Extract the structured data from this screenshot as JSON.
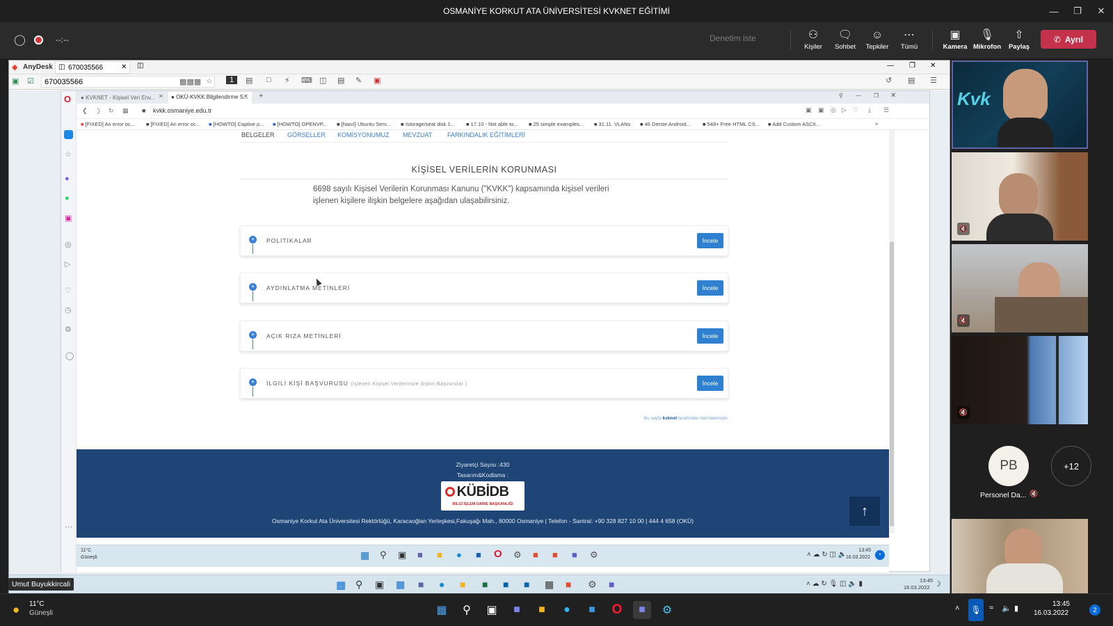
{
  "teams": {
    "title": "OSMANİYE KORKUT ATA ÜNİVERSİTESİ KVKNET EĞİTİMİ",
    "timer": "--:--",
    "ask_control": "Denetim iste",
    "buttons": {
      "people": "Kişiler",
      "chat": "Sohbet",
      "reactions": "Tepkiler",
      "more": "Tümü",
      "camera": "Kamera",
      "mic": "Mikrofon",
      "share": "Paylaş",
      "leave": "Ayrıl"
    },
    "presenter_name": "Umut Buyukkircali",
    "participant_initials": "PB",
    "participant_name": "Personel Da...",
    "more_count": "+12",
    "colors": {
      "leave": "#c4314b",
      "background": "#1f1f1f",
      "pb_circle": "#f4f1ea"
    }
  },
  "anydesk": {
    "brand": "AnyDesk",
    "tab_id": "670035566",
    "address": "670035566"
  },
  "browser": {
    "tabs": [
      "KVKNET - Kişisel Veri Env...",
      "OKÜ-KVKK Bilgilendirme S..."
    ],
    "url": "kvkk.osmaniye.edu.tr",
    "bookmarks": [
      "[FIXED] An error oc...",
      "[FIXED] An error oc...",
      "[HOWTO] Captive p...",
      "[HOWTO] OPENVP...",
      "[Nasıl] Ubuntu Serv...",
      "/storage/seat disk 1...",
      "17.10 - Not able to...",
      "25 simple examples...",
      "31.11. VLANs",
      "46 Derste Android...",
      "548+ Free HTML CS...",
      "Add Custom ASCII..."
    ]
  },
  "page": {
    "nav": [
      "BELGELER",
      "GÖRSELLER",
      "KOMİSYONUMUZ",
      "MEVZUAT",
      "FARKINDALIK EĞİTİMLERİ"
    ],
    "heading": "KİŞİSEL VERİLERİN KORUNMASI",
    "intro_line1": "6698 sayılı Kişisel Verilerin Korunması Kanunu (\"KVKK\") kapsamında kişisel verileri",
    "intro_line2": "işlenen kişilere ilişkin belgelere aşağıdan ulaşabilirsiniz.",
    "sections": [
      {
        "label": "POLİTİKALAR",
        "sub": "",
        "button": "İncele"
      },
      {
        "label": "AYDINLATMA METİNLERİ",
        "sub": "",
        "button": "İncele"
      },
      {
        "label": "AÇIK RIZA METİNLERİ",
        "sub": "",
        "button": "İncele"
      },
      {
        "label": "İLGİLİ KİŞİ BAŞVURUSU",
        "sub": "(İşlenen Kişisel Verilerinize İlişkin Başvurular )",
        "button": "İncele"
      }
    ],
    "credit_prefix": "Bu sayfa",
    "credit_brand": "kvknet",
    "credit_suffix": "tarafından hazırlanmıştır.",
    "footer": {
      "visitors": "Ziyaretçi Sayısı :430",
      "design": "Tasarım&Kodlama :",
      "logo_text": "KÜBİDB",
      "logo_sub": "BİLGİ İŞLEM DAİRE BAŞKANLIĞI",
      "address": "Osmaniye Korkut Ata Üniversitesi Rektörlüğü, Karacaoğlan Yerleşkesi,Fakuşağı Mah., 80000 Osmaniye | Telefon - Santral: +90 328 827 10 00 | 444 4 658 (OKÜ)"
    }
  },
  "remote_taskbar": {
    "weather_temp": "11°C",
    "weather_desc": "Güneşli",
    "time": "13:45",
    "date": "16.03.2022"
  },
  "taskbar": {
    "weather_temp": "11°C",
    "weather_desc": "Güneşli",
    "time": "13:45",
    "date": "16.03.2022",
    "notifications": "2"
  }
}
